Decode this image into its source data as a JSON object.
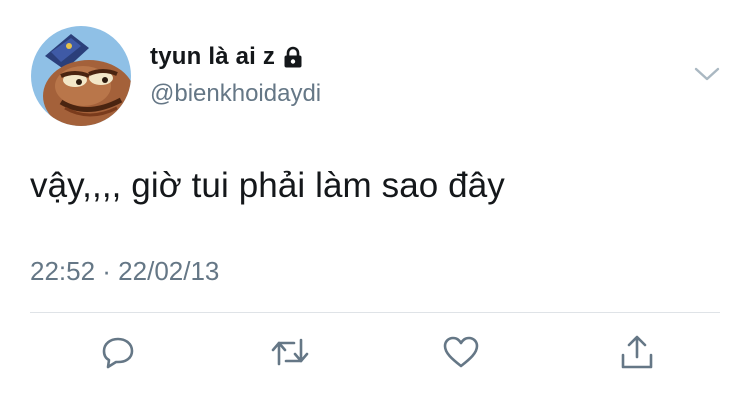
{
  "tweet": {
    "display_name": "tyun là ai z",
    "handle": "@bienkhoidaydi",
    "text": "vậy,,,, giờ tui phải làm sao đây",
    "timestamp": "22:52 · 22/02/13",
    "locked": true
  },
  "icons": {
    "lock": "lock-icon",
    "menu": "chevron-down-icon",
    "reply": "reply-icon",
    "retweet": "retweet-icon",
    "like": "heart-icon",
    "share": "share-icon"
  },
  "colors": {
    "text_primary": "#14171a",
    "text_secondary": "#657786",
    "icon": "#657786",
    "divider": "#dfe3e7"
  }
}
